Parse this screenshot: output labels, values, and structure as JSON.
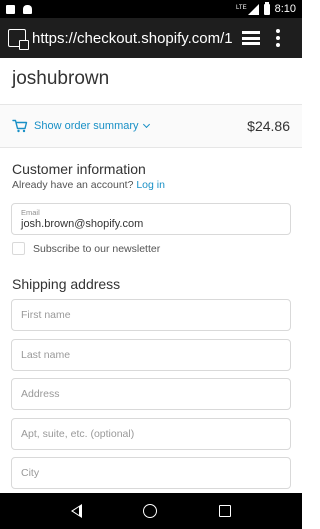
{
  "status_bar": {
    "network": "LTE",
    "time": "8:10"
  },
  "browser": {
    "url": "https://checkout.shopify.com/1("
  },
  "store": {
    "name": "joshubrown"
  },
  "order_summary": {
    "toggle_label": "Show order summary",
    "total": "$24.86"
  },
  "customer_info": {
    "title": "Customer information",
    "account_prompt": "Already have an account?",
    "login_link": "Log in",
    "email_label": "Email",
    "email_value": "josh.brown@shopify.com",
    "newsletter_label": "Subscribe to our newsletter"
  },
  "shipping": {
    "title": "Shipping address",
    "first_name_placeholder": "First name",
    "last_name_placeholder": "Last name",
    "address_placeholder": "Address",
    "apt_placeholder": "Apt, suite, etc. (optional)",
    "city_placeholder": "City"
  }
}
